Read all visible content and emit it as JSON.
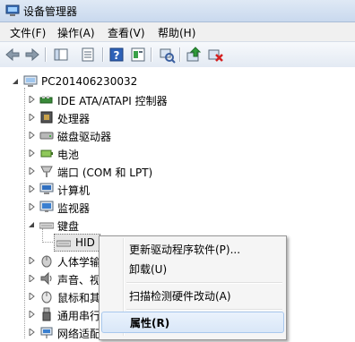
{
  "window": {
    "title": "设备管理器"
  },
  "menubar": {
    "items": [
      "文件(F)",
      "操作(A)",
      "查看(V)",
      "帮助(H)"
    ]
  },
  "toolbar": {
    "icons": [
      "back-arrow-icon",
      "forward-arrow-icon",
      "console-tree-icon",
      "properties-icon",
      "help-icon",
      "details-icon",
      "scan-hardware-icon",
      "update-driver-icon",
      "uninstall-device-icon"
    ]
  },
  "tree": {
    "root": "PC201406230032",
    "nodes": [
      {
        "label": "IDE ATA/ATAPI 控制器",
        "icon": "ide-controller-icon"
      },
      {
        "label": "处理器",
        "icon": "processor-icon"
      },
      {
        "label": "磁盘驱动器",
        "icon": "disk-drive-icon"
      },
      {
        "label": "电池",
        "icon": "battery-icon"
      },
      {
        "label": "端口 (COM 和 LPT)",
        "icon": "port-icon"
      },
      {
        "label": "计算机",
        "icon": "computer-icon"
      },
      {
        "label": "监视器",
        "icon": "monitor-icon"
      },
      {
        "label": "键盘",
        "icon": "keyboard-icon"
      },
      {
        "label": "HID",
        "icon": "keyboard-icon"
      },
      {
        "label": "人体学输",
        "icon": "hid-icon"
      },
      {
        "label": "声音、视",
        "icon": "sound-icon"
      },
      {
        "label": "鼠标和其",
        "icon": "mouse-icon"
      },
      {
        "label": "通用串行",
        "icon": "usb-icon"
      },
      {
        "label": "网络适配",
        "icon": "network-icon"
      }
    ]
  },
  "context_menu": {
    "items": [
      "更新驱动程序软件(P)...",
      "卸载(U)",
      "扫描检测硬件改动(A)",
      "属性(R)"
    ]
  }
}
